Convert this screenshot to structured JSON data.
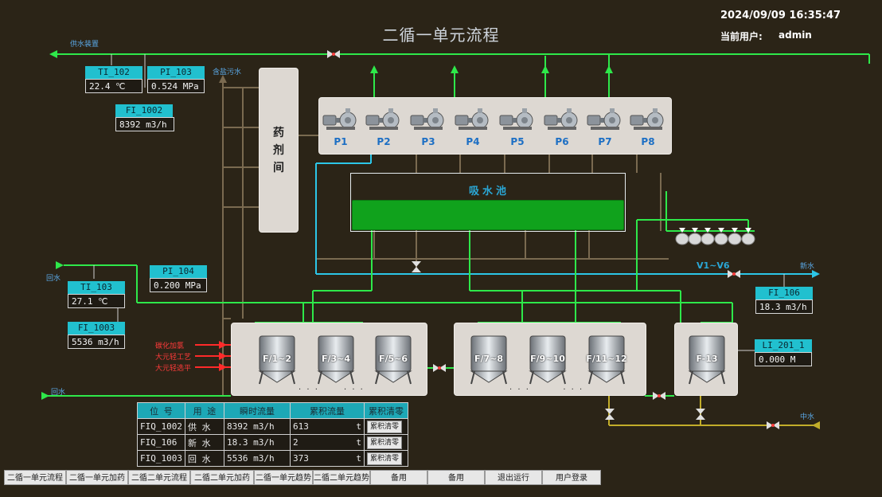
{
  "header": {
    "title": "二循一单元流程",
    "datetime": "2024/09/09 16:35:47",
    "user_label": "当前用户:",
    "user_name": "admin"
  },
  "labels": {
    "supply_water": "供水装置",
    "salt_water": "含盐污水",
    "return_water_top": "回水",
    "return_water_bottom": "回水",
    "new_water": "新水",
    "mid_water": "中水",
    "drug_room": "药剂间",
    "suction_pool": "吸水池",
    "v_group": "V1~V6"
  },
  "instruments": {
    "ti_102": {
      "tag": "TI_102",
      "value": "22.4  ℃"
    },
    "pi_103": {
      "tag": "PI_103",
      "value": "0.524  MPa"
    },
    "fi_1002": {
      "tag": "FI_1002",
      "value": "8392  m3/h"
    },
    "pi_104": {
      "tag": "PI_104",
      "value": "0.200  MPa"
    },
    "ti_103": {
      "tag": "TI_103",
      "value": "27.1  ℃"
    },
    "fi_1003": {
      "tag": "FI_1003",
      "value": "5536  m3/h"
    },
    "fi_106": {
      "tag": "FI_106",
      "value": "18.3  m3/h"
    },
    "li_201_1": {
      "tag": "LI_201_1",
      "value": "0.000  M"
    }
  },
  "pumps": [
    "P1",
    "P2",
    "P3",
    "P4",
    "P5",
    "P6",
    "P7",
    "P8"
  ],
  "filters": [
    "F/1~2",
    "F/3~4",
    "F/5~6",
    "F/7~8",
    "F/9~10",
    "F/11~12",
    "F-13"
  ],
  "process_notes": [
    "碳化加氯",
    "大元轻工艺",
    "大元轻选平"
  ],
  "flow_table": {
    "headers": [
      "位 号",
      "用 途",
      "瞬时流量",
      "累积流量",
      "累积清零"
    ],
    "rows": [
      {
        "tag": "FIQ_1002",
        "use": "供 水",
        "instant": "8392  m3/h",
        "total": "613",
        "unit": "t",
        "btn": "累积清零"
      },
      {
        "tag": "FIQ_106",
        "use": "新 水",
        "instant": "18.3  m3/h",
        "total": "2",
        "unit": "t",
        "btn": "累积清零"
      },
      {
        "tag": "FIQ_1003",
        "use": "回 水",
        "instant": "5536  m3/h",
        "total": "373",
        "unit": "t",
        "btn": "累积清零"
      }
    ]
  },
  "nav": [
    "二循一单元流程",
    "二循一单元加药",
    "二循二单元流程",
    "二循二单元加药",
    "二循一单元趋势",
    "二循二单元趋势",
    "备用",
    "备用",
    "退出运行",
    "用户登录"
  ],
  "colors": {
    "background": "#2b2417",
    "pipe_green": "#2ee84a",
    "pipe_blue": "#2cc6e8",
    "pipe_brown": "#7a6a50",
    "pipe_red": "#ff2a2a",
    "pipe_olive": "#c2ad2a",
    "panel": "#ddd8d2",
    "tag_cyan": "#21c0cf",
    "pool_green": "#10a21c"
  }
}
